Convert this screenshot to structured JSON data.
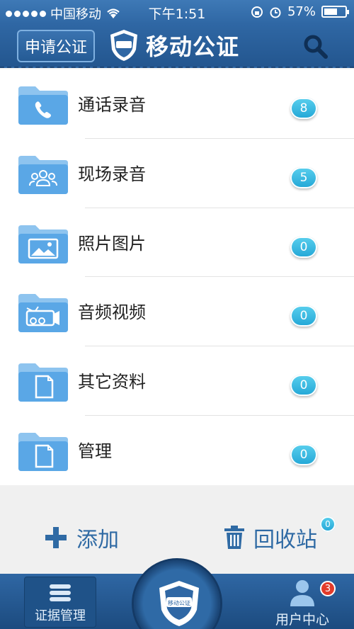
{
  "status_bar": {
    "carrier": "中国移动",
    "time": "下午1:51",
    "battery": "57%"
  },
  "header": {
    "apply_label": "申请公证",
    "title": "移动公证",
    "logo_text": "移动公证"
  },
  "folders": [
    {
      "label": "通话录音",
      "count": "8",
      "icon": "phone-folder-icon"
    },
    {
      "label": "现场录音",
      "count": "5",
      "icon": "people-folder-icon"
    },
    {
      "label": "照片图片",
      "count": "0",
      "icon": "picture-folder-icon"
    },
    {
      "label": "音频视频",
      "count": "0",
      "icon": "video-folder-icon"
    },
    {
      "label": "其它资料",
      "count": "0",
      "icon": "document-folder-icon"
    },
    {
      "label": "管理",
      "count": "0",
      "icon": "document-folder-icon"
    }
  ],
  "actions": {
    "add_label": "添加",
    "recycle_label": "回收站",
    "recycle_count": "0"
  },
  "tabbar": {
    "evidence_label": "证据管理",
    "user_label": "用户中心",
    "user_badge": "3"
  },
  "colors": {
    "brand_blue": "#2f67a4",
    "badge_cyan": "#22a6d6",
    "accent_text": "#2f6aa4"
  }
}
